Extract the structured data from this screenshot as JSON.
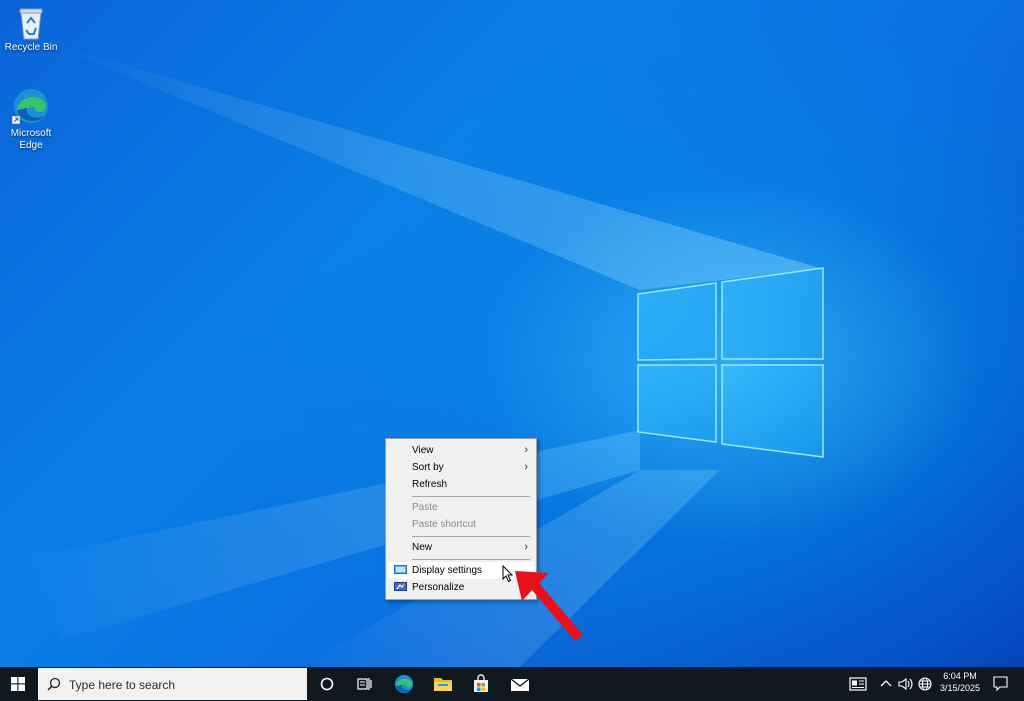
{
  "desktop": {
    "icons": [
      {
        "label": "Recycle Bin"
      },
      {
        "label": "Microsoft Edge"
      }
    ]
  },
  "context_menu": {
    "items": {
      "view": "View",
      "sort_by": "Sort by",
      "refresh": "Refresh",
      "paste": "Paste",
      "paste_shortcut": "Paste shortcut",
      "new": "New",
      "display_settings": "Display settings",
      "personalize": "Personalize"
    },
    "submenu_arrow": "›",
    "highlighted_item": "Display settings"
  },
  "taskbar": {
    "search_placeholder": "Type here to search",
    "pinned_apps": [
      "cortana-icon",
      "task-view-icon",
      "edge-icon",
      "file-explorer-icon",
      "microsoft-store-icon",
      "mail-icon"
    ],
    "clock": {
      "time": "6:04 PM",
      "date": "3/15/2025"
    }
  },
  "colors": {
    "desktop_blue": "#0a7fe6",
    "taskbar_bg": "#101820",
    "annotation_arrow": "#e8101a"
  }
}
